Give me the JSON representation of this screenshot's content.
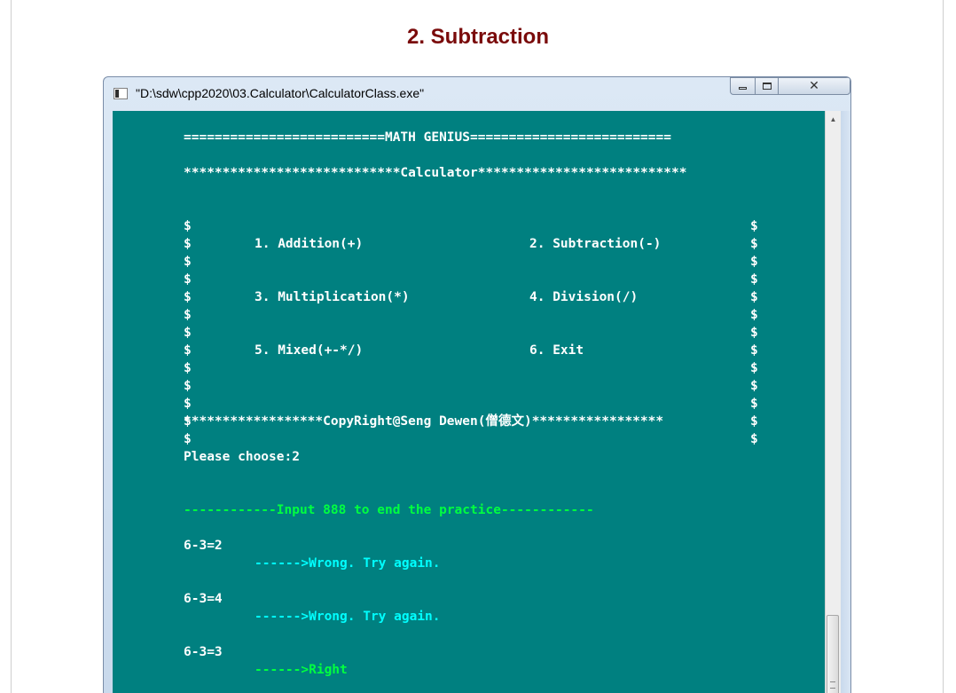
{
  "page": {
    "heading": "2. Subtraction"
  },
  "window": {
    "title": "\"D:\\sdw\\cpp2020\\03.Calculator\\CalculatorClass.exe\"",
    "buttons": {
      "minimize": "minimize-icon",
      "maximize": "maximize-icon",
      "close": "close-icon"
    }
  },
  "console": {
    "colors": {
      "background": "#008080",
      "text": "#ffffff",
      "green": "#00ff40",
      "cyan": "#00ffff"
    },
    "header": "==========================MATH GENIUS==========================",
    "menu_top": "****************************Calculator***************************",
    "border_char": "$",
    "options": [
      {
        "left": "1. Addition(+)",
        "right": "2. Subtraction(-)"
      },
      {
        "left": "3. Multiplication(*)",
        "right": "4. Division(/)"
      },
      {
        "left": "5. Mixed(+-*/)",
        "right": "6. Exit"
      }
    ],
    "menu_bottom": "******************CopyRight@Seng Dewen(僧德文)*****************",
    "prompt": "Please choose:2",
    "practice_banner_dashes_left": "------------",
    "practice_banner_text": "Input 888 to end the practice",
    "practice_banner_dashes_right": "------------",
    "attempts": [
      {
        "input": "6-3=2",
        "arrow": "------>",
        "feedback": "Wrong. Try again.",
        "result": "wrong"
      },
      {
        "input": "6-3=4",
        "arrow": "------>",
        "feedback": "Wrong. Try again.",
        "result": "wrong"
      },
      {
        "input": "6-3=3",
        "arrow": "------>",
        "feedback": "Right",
        "result": "right"
      }
    ]
  }
}
